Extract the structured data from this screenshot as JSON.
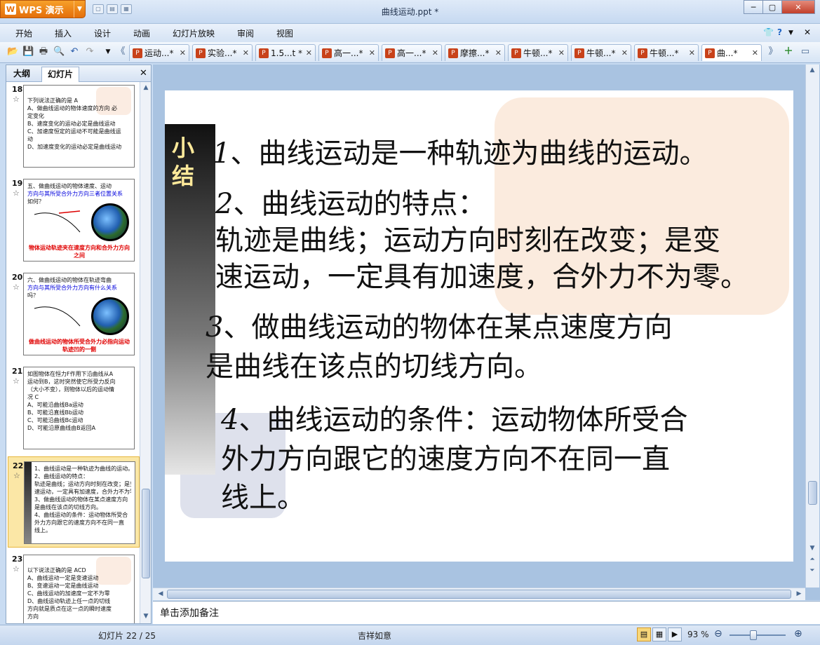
{
  "app": {
    "name": "WPS 演示",
    "logo": "W",
    "doc_title": "曲线运动.ppt *"
  },
  "menu": [
    "开始",
    "插入",
    "设计",
    "动画",
    "幻灯片放映",
    "审阅",
    "视图"
  ],
  "tabs": [
    {
      "label": "运动...*"
    },
    {
      "label": "实验...*"
    },
    {
      "label": "1.5...t *"
    },
    {
      "label": "高一...*"
    },
    {
      "label": "高一...*"
    },
    {
      "label": "摩擦...*"
    },
    {
      "label": "牛顿...*"
    },
    {
      "label": "牛顿...*"
    },
    {
      "label": "牛顿...*"
    },
    {
      "label": "曲...*"
    }
  ],
  "panel": {
    "tabs": [
      "大纲",
      "幻灯片"
    ],
    "slides": [
      {
        "num": "18",
        "lines": [
          "下列说法正确的是  A",
          "A、做曲线运动的物体速度的方向  必",
          "定变化",
          "B、速度变化的运动必定是曲线运动",
          "C、加速度恒定的运动不可能是曲线运",
          "动",
          "D、加速度变化的运动必定是曲线运动"
        ]
      },
      {
        "num": "19",
        "lines": [
          "五、做曲线运动的物体速度、运动",
          "方向与其所受合外力方向三者位置关系",
          "如何？"
        ],
        "footer": "物体运动轨迹夹在速度方向和合外力方向之间"
      },
      {
        "num": "20",
        "lines": [
          "六、做曲线运动的物体在轨迹弯曲",
          "方向与其所受合外力方向有什么关系",
          "吗？"
        ],
        "footer": "做曲线运动的物体所受合外力必指向运动轨迹凹的一侧"
      },
      {
        "num": "21",
        "lines": [
          "如图物体在恒力F作用下沿曲线从A",
          "运动到B，这时突然使它所受力反向",
          "（大小不变），则物体以后的运动情",
          "况  C",
          "A、可能沿曲线Ba运动",
          "B、可能沿直线Bb运动",
          "C、可能沿曲线Bc运动",
          "D、可能沿原曲线由B返回A"
        ]
      },
      {
        "num": "22",
        "lines": [
          "1、曲线运动是一种轨迹为曲线的运动。",
          "2、曲线运动的特点：",
          "轨迹是曲线；运动方向时刻在改变；是变",
          "速运动，一定具有加速度，合外力不为零。",
          "3、做曲线运动的物体在某点速度方向",
          "是曲线在该点的切线方向。",
          "4、曲线运动的条件：运动物体所受合",
          "外力方向跟它的速度方向不在同一直",
          "线上。"
        ]
      },
      {
        "num": "23",
        "lines": [
          "以下说法正确的是  ACD",
          "A、曲线运动一定是变速运动",
          "B、变速运动一定是曲线运动",
          "C、曲线运动的加速度一定不为零",
          "D、曲线运动轨迹上任一点的切线",
          "方向就是质点在这一点的瞬时速度",
          "方向"
        ]
      }
    ]
  },
  "slide": {
    "side_title": "小结",
    "p1_num": "1",
    "p1": "、曲线运动是一种轨迹为曲线的运动。",
    "p2_num": "2",
    "p2": "、曲线运动的特点：",
    "p2_line2": "轨迹是曲线；运动方向时刻在改变；是变",
    "p2_line3": "速运动，一定具有加速度，合外力不为零。",
    "p3_num": "3",
    "p3": "、做曲线运动的物体在某点速度方向",
    "p3_line2": "是曲线在该点的切线方向。",
    "p4_num": "4",
    "p4": "、曲线运动的条件：运动物体所受合",
    "p4_line2": "外力方向跟它的速度方向不在同一直",
    "p4_line3": "线上。"
  },
  "notes_placeholder": "单击添加备注",
  "status": {
    "slide_counter": "幻灯片 22 / 25",
    "theme": "吉祥如意",
    "zoom": "93 %",
    "zoom_level": 0.43
  }
}
